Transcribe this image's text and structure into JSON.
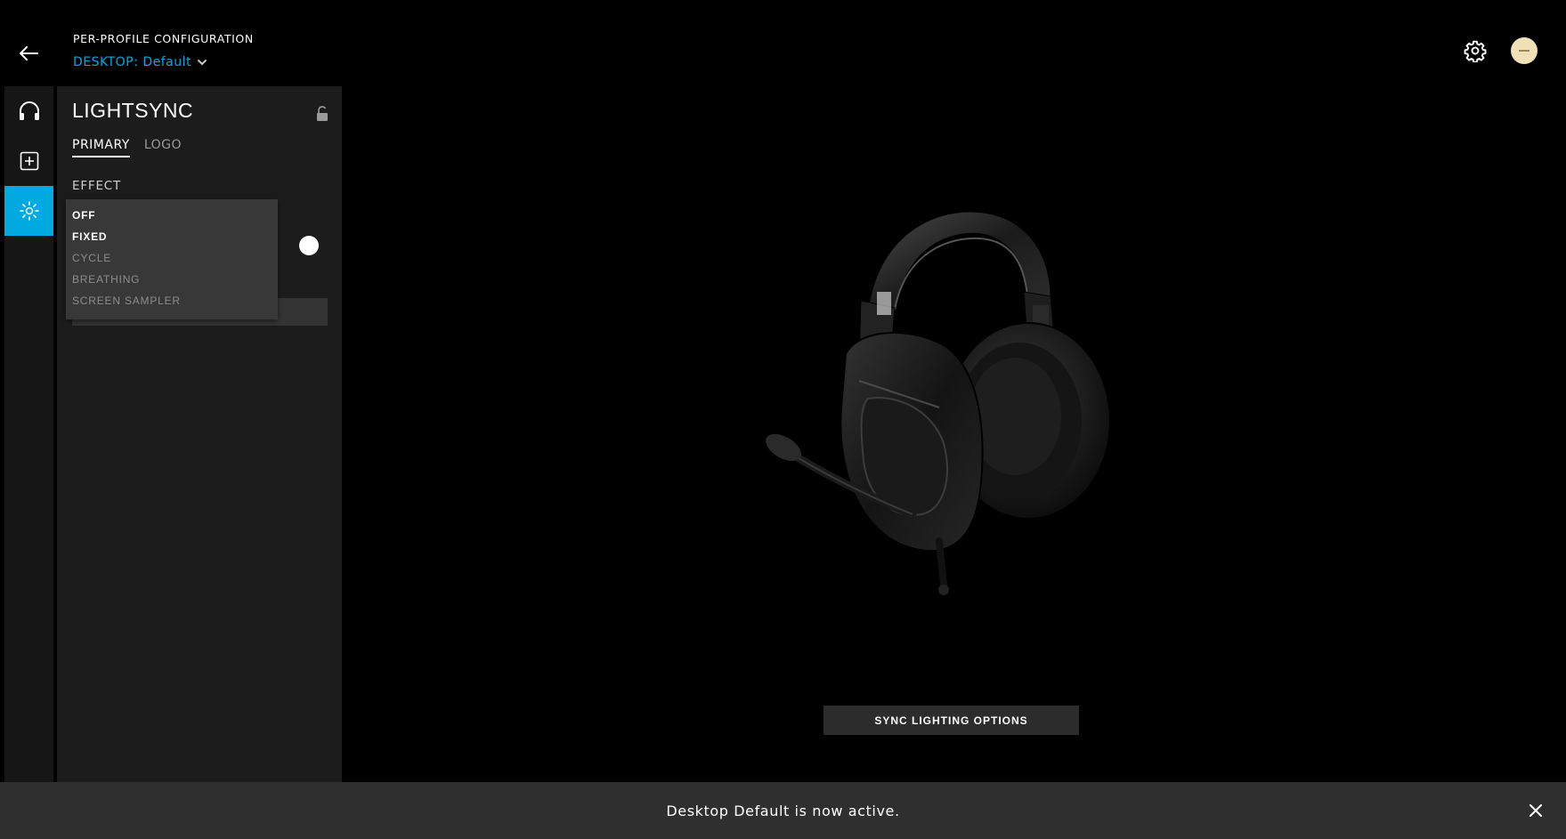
{
  "header": {
    "title": "PER-PROFILE CONFIGURATION",
    "profile_prefix": "DESKTOP:",
    "profile_name": "Default"
  },
  "rail": {
    "items": [
      {
        "icon": "headset-icon",
        "active": false
      },
      {
        "icon": "add-box-icon",
        "active": false
      },
      {
        "icon": "lightsync-icon",
        "active": true
      }
    ]
  },
  "panel": {
    "title": "LIGHTSYNC",
    "tabs": [
      {
        "label": "PRIMARY",
        "active": true
      },
      {
        "label": "LOGO",
        "active": false
      }
    ],
    "effect_label": "EFFECT",
    "effect_options": [
      "OFF",
      "FIXED",
      "CYCLE",
      "BREATHING",
      "SCREEN SAMPLER"
    ],
    "selected_color": "#ffffff"
  },
  "sync_button": "SYNC LIGHTING OPTIONS",
  "notification": {
    "message": "Desktop Default is now active."
  },
  "colors": {
    "accent": "#00a9e0",
    "background": "#000000",
    "panel": "#1c1c1c",
    "avatar": "#f0e2b6"
  }
}
